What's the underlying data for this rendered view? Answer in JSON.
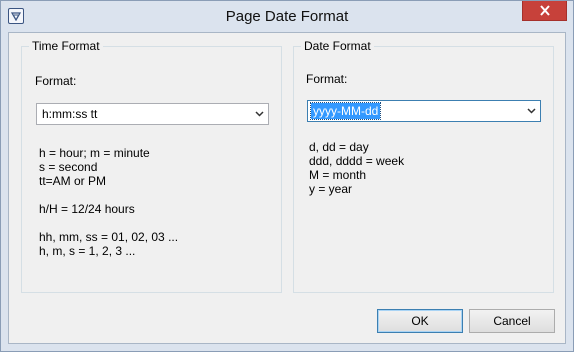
{
  "window": {
    "title": "Page Date Format"
  },
  "time_format": {
    "legend": "Time Format",
    "format_label": "Format:",
    "value": "h:mm:ss tt",
    "help_lines": [
      "h = hour; m = minute",
      "s = second",
      "tt=AM or PM",
      "h/H = 12/24 hours",
      "hh, mm, ss = 01, 02, 03 ...",
      "h, m, s = 1, 2, 3 ..."
    ]
  },
  "date_format": {
    "legend": "Date Format",
    "format_label": "Format:",
    "value": "yyyy-MM-dd",
    "help_lines": [
      "d, dd = day",
      "ddd, dddd = week",
      "M = month",
      "y = year"
    ]
  },
  "buttons": {
    "ok": "OK",
    "cancel": "Cancel"
  }
}
